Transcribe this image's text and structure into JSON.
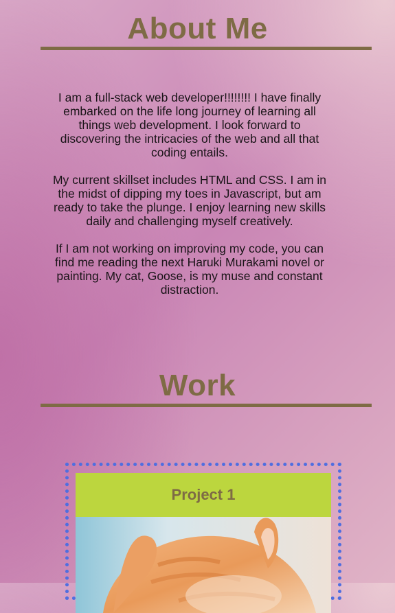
{
  "about": {
    "title": "About Me",
    "paragraphs": [
      "I am a full-stack web developer!!!!!!!! I have finally embarked on the life long journey of learning all things web development. I look forward to discovering the intricacies of the web and all that coding entails.",
      "My current skillset includes HTML and CSS. I am in the midst of dipping my toes in Javascript, but am ready to take the plunge. I enjoy learning new skills daily and challenging myself creatively.",
      "If I am not working on improving my code, you can find me reading the next Haruki Murakami novel or painting. My cat, Goose, is my muse and constant distraction."
    ]
  },
  "work": {
    "title": "Work",
    "projects": [
      {
        "title": "Project 1",
        "image": "orange-cat-photo"
      }
    ]
  },
  "colors": {
    "heading": "#7e6b45",
    "project_header_bg": "#bcd63e",
    "project_border": "#4f6ee0"
  }
}
